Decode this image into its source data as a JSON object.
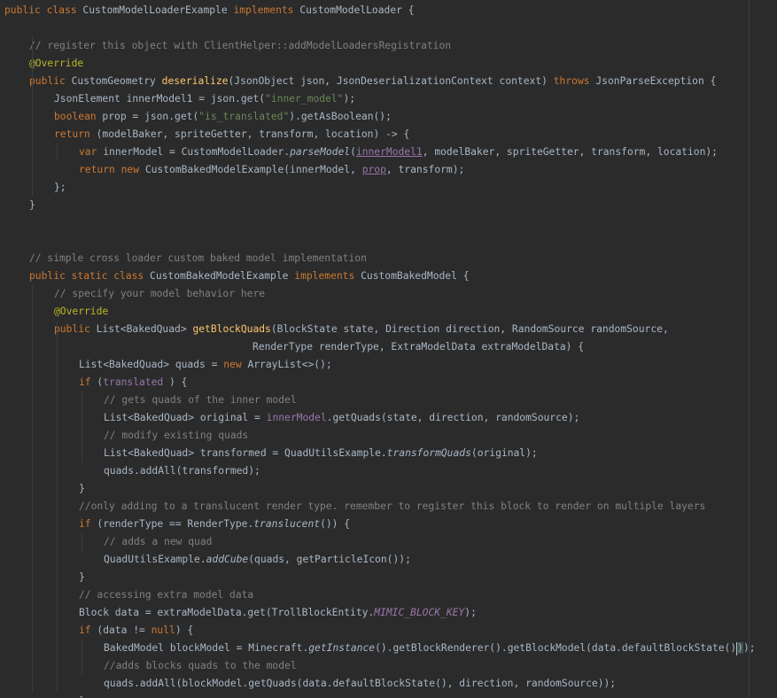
{
  "editor": {
    "lines": [
      {
        "indent": 0,
        "tokens": [
          [
            "kw",
            "public class "
          ],
          [
            "",
            "CustomModelLoaderExample "
          ],
          [
            "kw",
            "implements "
          ],
          [
            "",
            "CustomModelLoader "
          ],
          [
            "br",
            "{"
          ]
        ]
      },
      {
        "indent": 0,
        "tokens": []
      },
      {
        "indent": 4,
        "tokens": [
          [
            "cm",
            "// register this object with ClientHelper::addModelLoadersRegistration"
          ]
        ]
      },
      {
        "indent": 4,
        "tokens": [
          [
            "an",
            "@Override"
          ]
        ]
      },
      {
        "indent": 4,
        "tokens": [
          [
            "kw",
            "public "
          ],
          [
            "",
            "CustomGeometry "
          ],
          [
            "fn",
            "deserialize"
          ],
          [
            "",
            "(JsonObject json, JsonDeserializationContext context) "
          ],
          [
            "kw",
            "throws "
          ],
          [
            "",
            "JsonParseException "
          ],
          [
            "br",
            "{"
          ]
        ]
      },
      {
        "indent": 8,
        "tokens": [
          [
            "",
            "JsonElement innerModel1 = json.get("
          ],
          [
            "str",
            "\"inner_model\""
          ],
          [
            "",
            "); "
          ]
        ]
      },
      {
        "indent": 8,
        "tokens": [
          [
            "kw",
            "boolean "
          ],
          [
            "",
            "prop = json.get("
          ],
          [
            "str",
            "\"is_translated\""
          ],
          [
            "",
            ").getAsBoolean();"
          ]
        ]
      },
      {
        "indent": 8,
        "tokens": [
          [
            "kw",
            "return "
          ],
          [
            "",
            "(modelBaker, spriteGetter, transform, location) -> "
          ],
          [
            "br",
            "{"
          ]
        ]
      },
      {
        "indent": 12,
        "tokens": [
          [
            "kw",
            "var "
          ],
          [
            "",
            "innerModel = CustomModelLoader."
          ],
          [
            "it",
            "parseModel"
          ],
          [
            "",
            "("
          ],
          [
            "fldul",
            "innerModel1"
          ],
          [
            "",
            ", modelBaker, spriteGetter, transform, location);"
          ]
        ]
      },
      {
        "indent": 12,
        "tokens": [
          [
            "kw",
            "return new "
          ],
          [
            "",
            "CustomBakedModelExample(innerModel, "
          ],
          [
            "fldul",
            "prop"
          ],
          [
            "",
            ", transform);"
          ]
        ]
      },
      {
        "indent": 8,
        "tokens": [
          [
            "br",
            "};"
          ]
        ]
      },
      {
        "indent": 4,
        "tokens": [
          [
            "br",
            "}"
          ]
        ]
      },
      {
        "indent": 0,
        "tokens": []
      },
      {
        "indent": 0,
        "tokens": []
      },
      {
        "indent": 4,
        "tokens": [
          [
            "cm",
            "// simple cross loader custom baked model implementation"
          ]
        ]
      },
      {
        "indent": 4,
        "tokens": [
          [
            "kw",
            "public static class "
          ],
          [
            "",
            "CustomBakedModelExample "
          ],
          [
            "kw",
            "implements "
          ],
          [
            "",
            "CustomBakedModel "
          ],
          [
            "br",
            "{"
          ]
        ]
      },
      {
        "indent": 8,
        "tokens": [
          [
            "cm",
            "// specify your model behavior here"
          ]
        ]
      },
      {
        "indent": 8,
        "tokens": [
          [
            "an",
            "@Override"
          ]
        ]
      },
      {
        "indent": 8,
        "tokens": [
          [
            "kw",
            "public "
          ],
          [
            "",
            "List<BakedQuad> "
          ],
          [
            "fn",
            "getBlockQuads"
          ],
          [
            "",
            "(BlockState state, Direction direction, RandomSource randomSource,"
          ]
        ]
      },
      {
        "indent": 40,
        "tokens": [
          [
            "",
            "RenderType renderType, ExtraModelData extraModelData) "
          ],
          [
            "br",
            "{"
          ]
        ]
      },
      {
        "indent": 12,
        "tokens": [
          [
            "",
            "List<BakedQuad> quads = "
          ],
          [
            "kw",
            "new "
          ],
          [
            "",
            "ArrayList<>();"
          ]
        ]
      },
      {
        "indent": 12,
        "tokens": [
          [
            "kw",
            "if "
          ],
          [
            "",
            "("
          ],
          [
            "fld",
            "translated"
          ],
          [
            "",
            " ) "
          ],
          [
            "br",
            "{"
          ]
        ]
      },
      {
        "indent": 16,
        "tokens": [
          [
            "cm",
            "// gets quads of the inner model"
          ]
        ]
      },
      {
        "indent": 16,
        "tokens": [
          [
            "",
            "List<BakedQuad> original = "
          ],
          [
            "fld",
            "innerModel"
          ],
          [
            "",
            ".getQuads(state, direction, randomSource);"
          ]
        ]
      },
      {
        "indent": 16,
        "tokens": [
          [
            "cm",
            "// modify existing quads"
          ]
        ]
      },
      {
        "indent": 16,
        "tokens": [
          [
            "",
            "List<BakedQuad> transformed = QuadUtilsExample."
          ],
          [
            "it",
            "transformQuads"
          ],
          [
            "",
            "(original);"
          ]
        ]
      },
      {
        "indent": 16,
        "tokens": [
          [
            "",
            "quads.addAll(transformed);"
          ]
        ]
      },
      {
        "indent": 12,
        "tokens": [
          [
            "br",
            "}"
          ]
        ]
      },
      {
        "indent": 12,
        "tokens": [
          [
            "cm",
            "//only adding to a translucent render type. remember to register this block to render on multiple layers"
          ]
        ]
      },
      {
        "indent": 12,
        "tokens": [
          [
            "kw",
            "if "
          ],
          [
            "",
            "(renderType == RenderType."
          ],
          [
            "it",
            "translucent"
          ],
          [
            "",
            "()) "
          ],
          [
            "br",
            "{"
          ]
        ]
      },
      {
        "indent": 16,
        "tokens": [
          [
            "cm",
            "// adds a new quad"
          ]
        ]
      },
      {
        "indent": 16,
        "tokens": [
          [
            "",
            "QuadUtilsExample."
          ],
          [
            "it",
            "addCube"
          ],
          [
            "",
            "(quads, getParticleIcon());"
          ]
        ]
      },
      {
        "indent": 12,
        "tokens": [
          [
            "br",
            "}"
          ]
        ]
      },
      {
        "indent": 12,
        "tokens": [
          [
            "cm",
            "// accessing extra model data"
          ]
        ]
      },
      {
        "indent": 12,
        "tokens": [
          [
            "",
            "Block data = extraModelData.get(TrollBlockEntity."
          ],
          [
            "st",
            "MIMIC_BLOCK_KEY"
          ],
          [
            "",
            ");"
          ]
        ]
      },
      {
        "indent": 12,
        "tokens": [
          [
            "kw",
            "if "
          ],
          [
            "",
            "(data != "
          ],
          [
            "kw",
            "null"
          ],
          [
            "",
            ") "
          ],
          [
            "br",
            "{"
          ]
        ]
      },
      {
        "indent": 16,
        "tokens": [
          [
            "",
            "BakedModel blockModel = Minecraft."
          ],
          [
            "it",
            "getInstance"
          ],
          [
            "",
            "().getBlockRenderer().getBlockModel(data.defaultBlockState()"
          ],
          [
            "cur",
            ""
          ],
          [
            "brm",
            ")"
          ],
          [
            "",
            ");"
          ]
        ]
      },
      {
        "indent": 16,
        "tokens": [
          [
            "cm",
            "//adds blocks quads to the model"
          ]
        ]
      },
      {
        "indent": 16,
        "tokens": [
          [
            "",
            "quads.addAll(blockModel.getQuads(data.defaultBlockState(), direction, randomSource));"
          ]
        ]
      },
      {
        "indent": 12,
        "tokens": [
          [
            "br",
            "}"
          ]
        ]
      }
    ]
  }
}
